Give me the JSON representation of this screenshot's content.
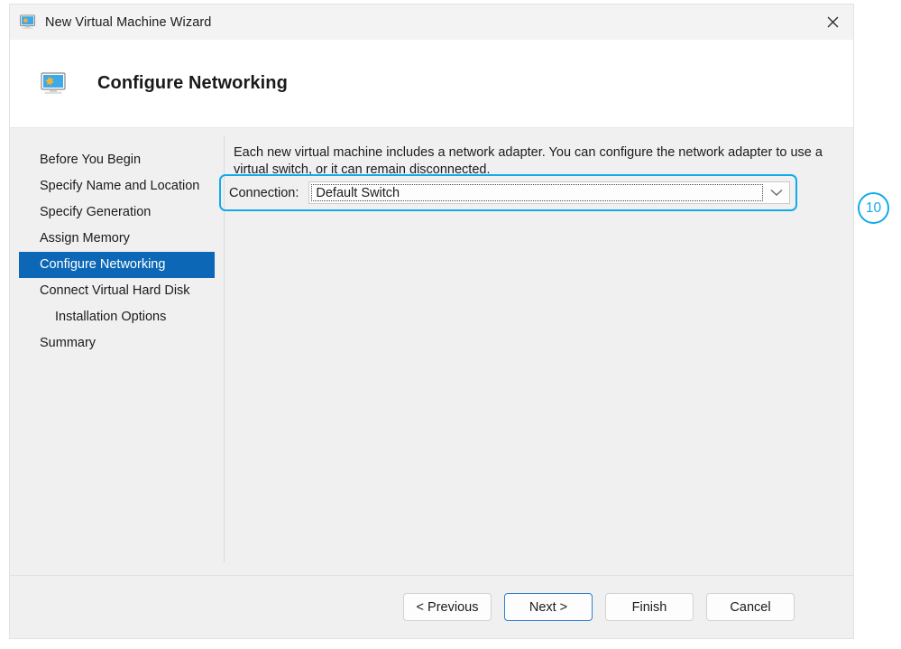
{
  "window": {
    "title": "New Virtual Machine Wizard",
    "title_icon": "virtual-machine-monitor-icon",
    "close_icon": "close-icon"
  },
  "header": {
    "title": "Configure Networking",
    "icon": "virtual-machine-monitor-icon"
  },
  "sidebar": {
    "items": [
      {
        "label": "Before You Begin",
        "selected": false,
        "indented": false
      },
      {
        "label": "Specify Name and Location",
        "selected": false,
        "indented": false
      },
      {
        "label": "Specify Generation",
        "selected": false,
        "indented": false
      },
      {
        "label": "Assign Memory",
        "selected": false,
        "indented": false
      },
      {
        "label": "Configure Networking",
        "selected": true,
        "indented": false
      },
      {
        "label": "Connect Virtual Hard Disk",
        "selected": false,
        "indented": false
      },
      {
        "label": "Installation Options",
        "selected": false,
        "indented": true
      },
      {
        "label": "Summary",
        "selected": false,
        "indented": false
      }
    ]
  },
  "content": {
    "intro_text": "Each new virtual machine includes a network adapter. You can configure the network adapter to use a virtual switch, or it can remain disconnected.",
    "connection_label": "Connection:",
    "connection_value": "Default Switch",
    "connection_arrow_icon": "chevron-down-icon"
  },
  "annotation": {
    "badge_number": "10",
    "color": "#12aaeb"
  },
  "footer": {
    "previous_label": "< Previous",
    "next_label": "Next >",
    "finish_label": "Finish",
    "cancel_label": "Cancel"
  },
  "colors": {
    "selection_blue": "#0c68b6",
    "annotation_cyan": "#12aaeb",
    "default_button_border": "#2f7fd0",
    "window_background": "#f0f0f0",
    "header_background": "#ffffff"
  }
}
